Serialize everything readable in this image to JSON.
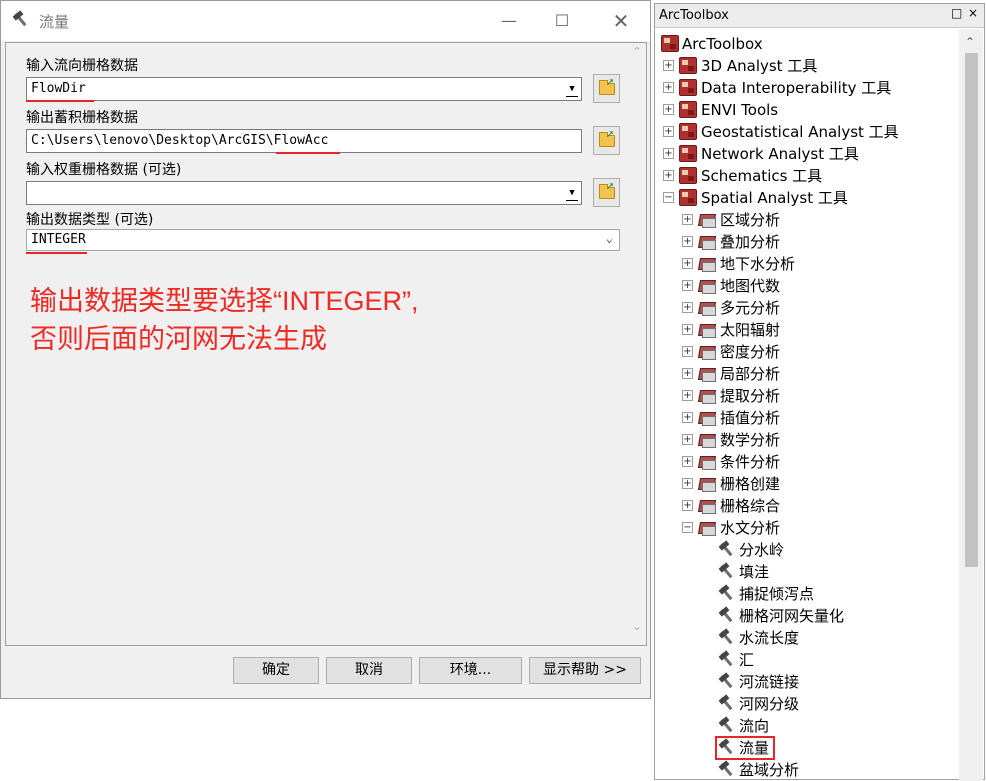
{
  "dialog": {
    "title": "流量",
    "fields": {
      "flow_dir_label": "输入流向栅格数据",
      "flow_dir_value": "FlowDir",
      "flow_acc_label": "输出蓄积栅格数据",
      "flow_acc_value": "C:\\Users\\lenovo\\Desktop\\ArcGIS\\FlowAcc",
      "weight_label": "输入权重栅格数据 (可选)",
      "weight_value": "",
      "data_type_label": "输出数据类型 (可选)",
      "data_type_value": "INTEGER"
    },
    "annotation_line1": "输出数据类型要选择“INTEGER”,",
    "annotation_line2": "否则后面的河网无法生成",
    "buttons": {
      "ok": "确定",
      "cancel": "取消",
      "env": "环境...",
      "help": "显示帮助 >>"
    }
  },
  "toolbox": {
    "title": "ArcToolbox",
    "controls": {
      "pin": "□",
      "close": "×"
    },
    "items": [
      {
        "label": "ArcToolbox",
        "kind": "root"
      },
      {
        "label": "3D Analyst 工具",
        "kind": "toolbox",
        "state": "collapsed"
      },
      {
        "label": "Data Interoperability 工具",
        "kind": "toolbox",
        "state": "collapsed"
      },
      {
        "label": "ENVI Tools",
        "kind": "toolbox",
        "state": "collapsed"
      },
      {
        "label": "Geostatistical Analyst 工具",
        "kind": "toolbox",
        "state": "collapsed"
      },
      {
        "label": "Network Analyst 工具",
        "kind": "toolbox",
        "state": "collapsed"
      },
      {
        "label": "Schematics 工具",
        "kind": "toolbox",
        "state": "collapsed"
      },
      {
        "label": "Spatial Analyst 工具",
        "kind": "toolbox",
        "state": "expanded"
      },
      {
        "label": "区域分析",
        "kind": "toolset",
        "state": "collapsed"
      },
      {
        "label": "叠加分析",
        "kind": "toolset",
        "state": "collapsed"
      },
      {
        "label": "地下水分析",
        "kind": "toolset",
        "state": "collapsed"
      },
      {
        "label": "地图代数",
        "kind": "toolset",
        "state": "collapsed"
      },
      {
        "label": "多元分析",
        "kind": "toolset",
        "state": "collapsed"
      },
      {
        "label": "太阳辐射",
        "kind": "toolset",
        "state": "collapsed"
      },
      {
        "label": "密度分析",
        "kind": "toolset",
        "state": "collapsed"
      },
      {
        "label": "局部分析",
        "kind": "toolset",
        "state": "collapsed"
      },
      {
        "label": "提取分析",
        "kind": "toolset",
        "state": "collapsed"
      },
      {
        "label": "插值分析",
        "kind": "toolset",
        "state": "collapsed"
      },
      {
        "label": "数学分析",
        "kind": "toolset",
        "state": "collapsed"
      },
      {
        "label": "条件分析",
        "kind": "toolset",
        "state": "collapsed"
      },
      {
        "label": "栅格创建",
        "kind": "toolset",
        "state": "collapsed"
      },
      {
        "label": "栅格综合",
        "kind": "toolset",
        "state": "collapsed"
      },
      {
        "label": "水文分析",
        "kind": "toolset",
        "state": "expanded"
      },
      {
        "label": "分水岭",
        "kind": "tool"
      },
      {
        "label": "填洼",
        "kind": "tool"
      },
      {
        "label": "捕捉倾泻点",
        "kind": "tool"
      },
      {
        "label": "栅格河网矢量化",
        "kind": "tool"
      },
      {
        "label": "水流长度",
        "kind": "tool"
      },
      {
        "label": "汇",
        "kind": "tool"
      },
      {
        "label": "河流链接",
        "kind": "tool"
      },
      {
        "label": "河网分级",
        "kind": "tool"
      },
      {
        "label": "流向",
        "kind": "tool"
      },
      {
        "label": "流量",
        "kind": "tool",
        "highlighted": true
      },
      {
        "label": "盆域分析",
        "kind": "tool"
      }
    ]
  },
  "colors": {
    "annotation": "#ee2a24",
    "highlight": "#e8262a"
  }
}
